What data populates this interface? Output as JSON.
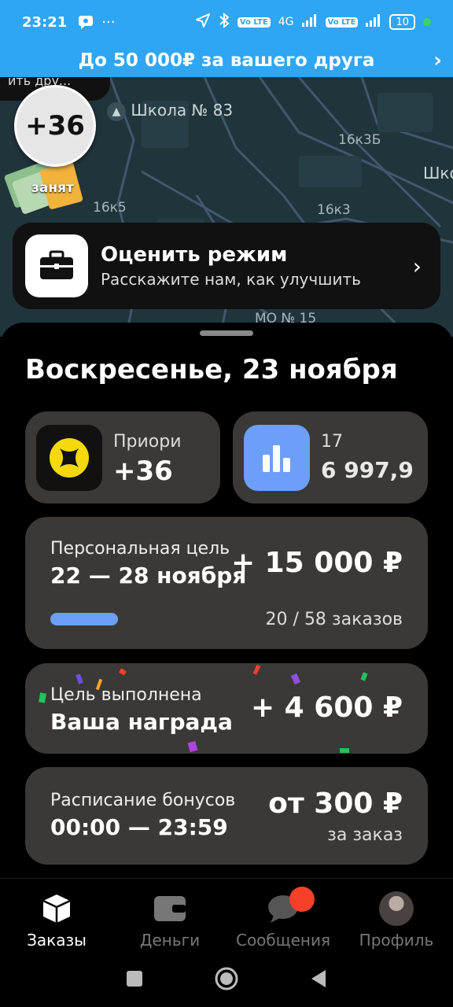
{
  "status": {
    "time": "23:21",
    "more": "···",
    "lte1": "Vo LTE",
    "net": "4G",
    "lte2": "Vo LTE",
    "battery": "10"
  },
  "promo": {
    "text": "До 50 000₽ за вашего друга"
  },
  "map": {
    "pill_text": "ить дру...",
    "school_label": "Школа № 83",
    "labels": [
      "16к3Б",
      "16к5",
      "16к3",
      "Шко",
      "МО № 15"
    ],
    "score": "+36",
    "busy": "занят"
  },
  "rate_card": {
    "title": "Оценить режим",
    "subtitle": "Расскажите нам, как улучшить"
  },
  "sheet": {
    "date": "Воскресенье, 23 ноября",
    "priority": {
      "label": "Приори",
      "value": "+36"
    },
    "stats": {
      "label": "17",
      "value": "6 997,9"
    },
    "goal": {
      "label": "Персональная цель",
      "dates": "22 — 28 ноября",
      "amount": "+ 15 000 ₽",
      "progress_text": "20 / 58 заказов",
      "done": 20,
      "total": 58
    },
    "done": {
      "label": "Цель выполнена",
      "title": "Ваша награда",
      "amount": "+ 4 600 ₽"
    },
    "schedule": {
      "label": "Расписание бонусов",
      "time": "00:00 — 23:59",
      "amount": "от 300 ₽",
      "note": "за заказ"
    }
  },
  "nav": {
    "items": [
      {
        "label": "Заказы"
      },
      {
        "label": "Деньги"
      },
      {
        "label": "Сообщения"
      },
      {
        "label": "Профиль"
      }
    ]
  },
  "colors": {
    "promo_bg": "#2fa6f3",
    "tile_bg": "#3a3937",
    "accent_blue": "#6d9ef8",
    "badge_red": "#f5412a",
    "priority_yellow": "#f5d90a"
  }
}
